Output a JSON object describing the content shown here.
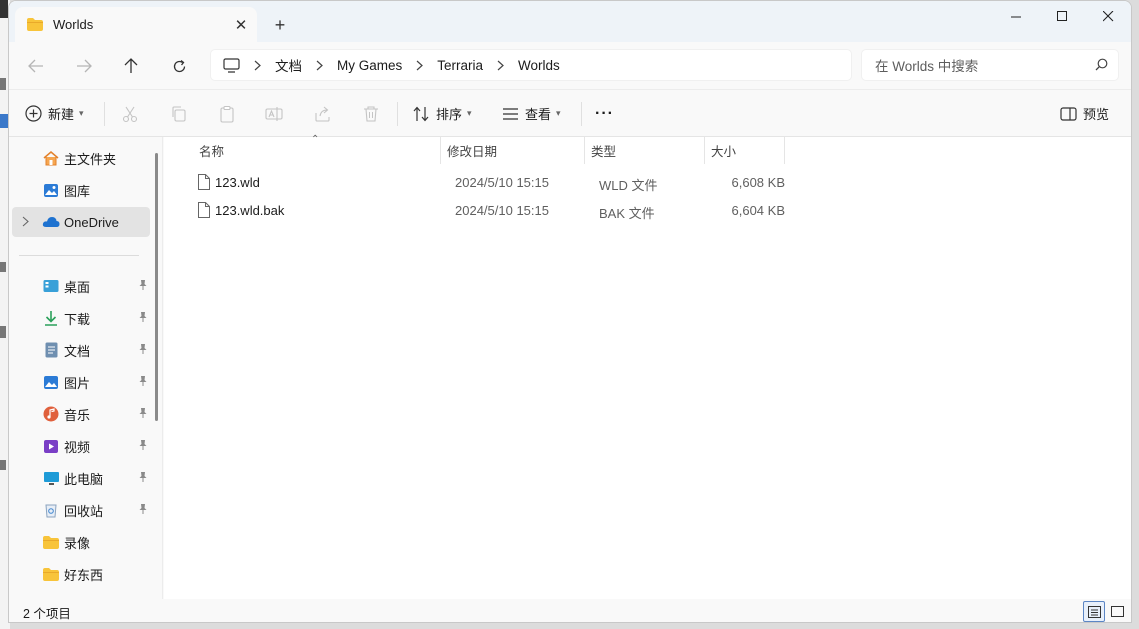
{
  "window": {
    "tab_title": "Worlds"
  },
  "titlebar": {
    "new_tab": "+",
    "close_tab": "✕"
  },
  "breadcrumb": [
    "文档",
    "My Games",
    "Terraria",
    "Worlds"
  ],
  "search": {
    "placeholder": "在 Worlds 中搜索"
  },
  "toolbar": {
    "new_label": "新建",
    "sort_label": "排序",
    "view_label": "查看",
    "more_label": "···",
    "preview_label": "预览"
  },
  "sidebar": {
    "items": [
      {
        "label": "主文件夹",
        "icon": "home-icon"
      },
      {
        "label": "图库",
        "icon": "gallery-icon"
      },
      {
        "label": "OneDrive",
        "icon": "cloud-icon"
      },
      {
        "label": "桌面",
        "icon": "desktop-icon"
      },
      {
        "label": "下载",
        "icon": "download-icon"
      },
      {
        "label": "文档",
        "icon": "document-icon"
      },
      {
        "label": "图片",
        "icon": "pictures-icon"
      },
      {
        "label": "音乐",
        "icon": "music-icon"
      },
      {
        "label": "视频",
        "icon": "video-icon"
      },
      {
        "label": "此电脑",
        "icon": "computer-icon"
      },
      {
        "label": "回收站",
        "icon": "recycle-bin-icon"
      },
      {
        "label": "录像",
        "icon": "folder-icon"
      },
      {
        "label": "好东西",
        "icon": "folder-icon"
      }
    ]
  },
  "columns": {
    "name": "名称",
    "date": "修改日期",
    "type": "类型",
    "size": "大小"
  },
  "files": [
    {
      "name": "123.wld",
      "date": "2024/5/10 15:15",
      "type": "WLD 文件",
      "size": "6,608 KB"
    },
    {
      "name": "123.wld.bak",
      "date": "2024/5/10 15:15",
      "type": "BAK 文件",
      "size": "6,604 KB"
    }
  ],
  "status": {
    "count": "2 个项目"
  },
  "colors": {
    "accent": "#0067c0",
    "folder": "#f8c43a",
    "selected_bg": "#e3e3e3"
  }
}
